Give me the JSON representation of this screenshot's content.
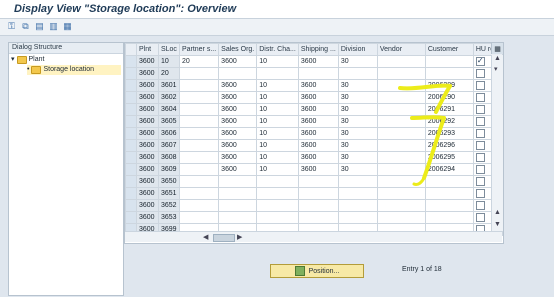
{
  "window": {
    "title": "Display View \"Storage location\": Overview"
  },
  "toolbar": {
    "icons": [
      "key-icon",
      "details-icon",
      "select-all-icon",
      "deselect-icon",
      "config-icon"
    ]
  },
  "dialog_structure": {
    "title": "Dialog Structure",
    "nodes": [
      {
        "label": "Plant",
        "expanded": true
      },
      {
        "label": "Storage location",
        "selected": true
      }
    ]
  },
  "table": {
    "columns": [
      "Plnt",
      "SLoc",
      "Partner s...",
      "Sales Org.",
      "Distr. Cha...",
      "Shipping ...",
      "Division",
      "Vendor",
      "Customer",
      "HU req."
    ],
    "rows": [
      [
        "3600",
        "10",
        "20",
        "3600",
        "10",
        "3600",
        "30",
        "",
        "",
        true
      ],
      [
        "3600",
        "20",
        "",
        "",
        "",
        "",
        "",
        "",
        "",
        false
      ],
      [
        "3600",
        "3601",
        "",
        "3600",
        "10",
        "3600",
        "30",
        "",
        "2006289",
        false
      ],
      [
        "3600",
        "3602",
        "",
        "3600",
        "10",
        "3600",
        "30",
        "",
        "2006290",
        false
      ],
      [
        "3600",
        "3604",
        "",
        "3600",
        "10",
        "3600",
        "30",
        "",
        "2006291",
        false
      ],
      [
        "3600",
        "3605",
        "",
        "3600",
        "10",
        "3600",
        "30",
        "",
        "2006292",
        false
      ],
      [
        "3600",
        "3606",
        "",
        "3600",
        "10",
        "3600",
        "30",
        "",
        "2006293",
        false
      ],
      [
        "3600",
        "3607",
        "",
        "3600",
        "10",
        "3600",
        "30",
        "",
        "2006296",
        false
      ],
      [
        "3600",
        "3608",
        "",
        "3600",
        "10",
        "3600",
        "30",
        "",
        "2006295",
        false
      ],
      [
        "3600",
        "3609",
        "",
        "3600",
        "10",
        "3600",
        "30",
        "",
        "2006294",
        false
      ],
      [
        "3600",
        "3650",
        "",
        "",
        "",
        "",
        "",
        "",
        "",
        false
      ],
      [
        "3600",
        "3651",
        "",
        "",
        "",
        "",
        "",
        "",
        "",
        false
      ],
      [
        "3600",
        "3652",
        "",
        "",
        "",
        "",
        "",
        "",
        "",
        false
      ],
      [
        "3600",
        "3653",
        "",
        "",
        "",
        "",
        "",
        "",
        "",
        false
      ],
      [
        "3600",
        "3699",
        "",
        "",
        "",
        "",
        "",
        "",
        "",
        false
      ]
    ]
  },
  "footer": {
    "position_label": "Position...",
    "entry_info": "Entry 1 of 18"
  },
  "colors": {
    "title_text": "#1f3b57",
    "highlight_marker": "#ecec1a",
    "position_button": "#f7e9a6"
  }
}
